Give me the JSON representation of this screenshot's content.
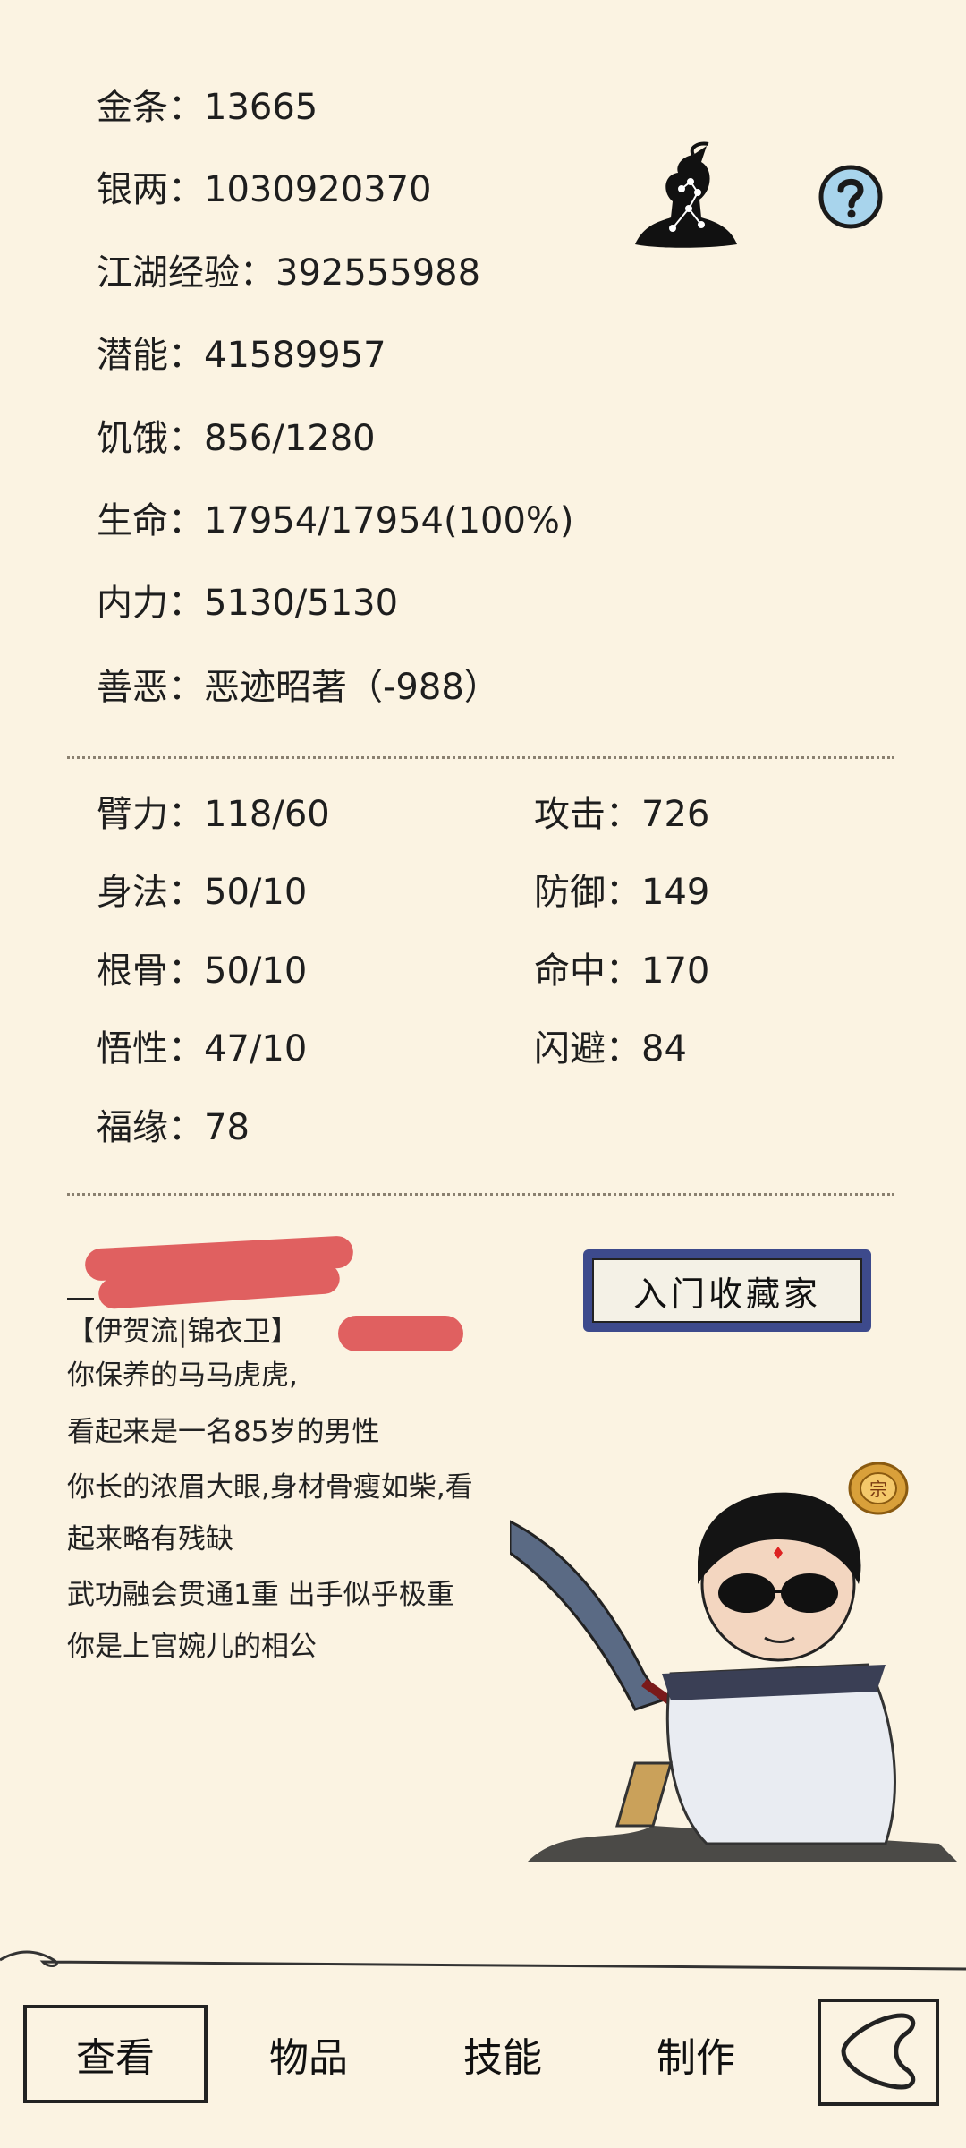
{
  "stats": {
    "gold": {
      "label": "金条：",
      "value": "13665"
    },
    "silver": {
      "label": "银两：",
      "value": "1030920370"
    },
    "exp": {
      "label": "江湖经验：",
      "value": "392555988"
    },
    "potential": {
      "label": "潜能：",
      "value": "41589957"
    },
    "hunger": {
      "label": "饥饿：",
      "value": "856/1280"
    },
    "life": {
      "label": "生命：",
      "value": "17954/17954(100%)"
    },
    "inner": {
      "label": "内力：",
      "value": "5130/5130"
    },
    "karma": {
      "label": "善恶：",
      "value": "恶迹昭著（-988）"
    }
  },
  "attributes": {
    "left": [
      {
        "label": "臂力：",
        "value": "118/60"
      },
      {
        "label": "身法：",
        "value": "50/10"
      },
      {
        "label": "根骨：",
        "value": "50/10"
      },
      {
        "label": "悟性：",
        "value": "47/10"
      },
      {
        "label": "福缘：",
        "value": "78"
      }
    ],
    "right": [
      {
        "label": "攻击：",
        "value": "726"
      },
      {
        "label": "防御：",
        "value": "149"
      },
      {
        "label": "命中：",
        "value": "170"
      },
      {
        "label": "闪避：",
        "value": "84"
      }
    ]
  },
  "bio": {
    "faction": "【伊贺流|锦衣卫】",
    "lines": [
      "你保养的马马虎虎,",
      "看起来是一名85岁的男性",
      "你长的浓眉大眼,身材骨瘦如柴,看",
      "起来略有残缺",
      "武功融会贯通1重 出手似乎极重",
      "你是上官婉儿的相公"
    ]
  },
  "badge": {
    "title": "入门收藏家"
  },
  "icons": {
    "meditate": "meditating-figure-icon",
    "help": "help-icon",
    "sect": "sect-emblem-icon",
    "back": "back-arrow-icon"
  },
  "nav": {
    "tabs": [
      {
        "label": "查看",
        "active": true
      },
      {
        "label": "物品",
        "active": false
      },
      {
        "label": "技能",
        "active": false
      },
      {
        "label": "制作",
        "active": false
      }
    ]
  },
  "colors": {
    "background": "#fbf3e2",
    "redaction": "#e06060",
    "badge_frame": "#3d4a8c",
    "help_fill": "#a8d4ec"
  }
}
